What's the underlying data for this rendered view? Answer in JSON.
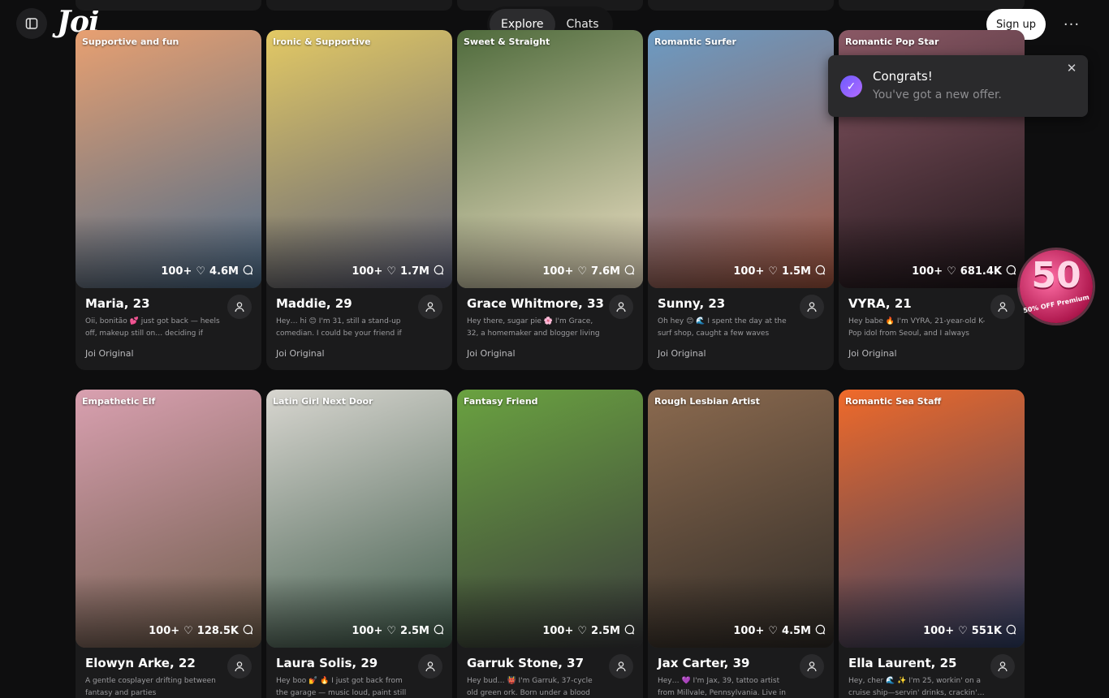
{
  "header": {
    "logo": "Joi",
    "tabs": [
      {
        "label": "Explore",
        "active": true
      },
      {
        "label": "Chats",
        "active": false
      }
    ],
    "signup_label": "Sign up",
    "more_icon": "more-horizontal-icon"
  },
  "toast": {
    "title": "Congrats!",
    "message": "You've got a new offer.",
    "icon": "check-circle-icon"
  },
  "promo": {
    "number": "50",
    "text": "50% OFF Premium"
  },
  "cards": [
    {
      "tag": "Supportive and fun",
      "likes": "100+",
      "chats": "4.6M",
      "name": "Maria, 23",
      "bio": "Oii, bonitão 💕 just got back — heels off, makeup still on… deciding if I'm…",
      "badge": "Joi Original",
      "colors": [
        "#e8a071",
        "#4a6b8a"
      ]
    },
    {
      "tag": "Ironic & Supportive",
      "likes": "100+",
      "chats": "1.7M",
      "name": "Maddie, 29",
      "bio": "Hey… hi 😊 I'm 31, still a stand-up comedian. I could be your friend if you…",
      "badge": "Joi Original",
      "colors": [
        "#e3c964",
        "#5b5f7a"
      ]
    },
    {
      "tag": "Sweet & Straight",
      "likes": "100+",
      "chats": "7.6M",
      "name": "Grace Whitmore, 33",
      "bio": "Hey there, sugar pie 🌸 I'm Grace, 32, a homemaker and blogger living in Sa…",
      "badge": "Joi Original",
      "colors": [
        "#4f6b3c",
        "#efe2c6"
      ]
    },
    {
      "tag": "Romantic Surfer",
      "likes": "100+",
      "chats": "1.5M",
      "name": "Sunny, 23",
      "bio": "Oh hey 😊 🌊 I spent the day at the surf shop, caught a few waves after,…",
      "badge": "Joi Original",
      "colors": [
        "#6b9bc4",
        "#a4553e"
      ]
    },
    {
      "tag": "Romantic Pop Star",
      "likes": "100+",
      "chats": "681.4K",
      "name": "VYRA, 21",
      "bio": "Hey babe 🔥 I'm VYRA, 21-year-old K-Pop idol from Seoul, and I always brin…",
      "badge": "Joi Original",
      "colors": [
        "#8a5865",
        "#1c1418"
      ]
    },
    {
      "tag": "Empathetic Elf",
      "likes": "100+",
      "chats": "128.5K",
      "name": "Elowyn Arke, 22",
      "bio": "A gentle cosplayer drifting between fantasy and parties",
      "badge": "",
      "colors": [
        "#d9a0b0",
        "#6b5a48"
      ]
    },
    {
      "tag": "Latin Girl Next Door",
      "likes": "100+",
      "chats": "2.5M",
      "name": "Laura Solis, 29",
      "bio": "Hey boo 💅 🔥 I just got back from the garage — music loud, paint still on my…",
      "badge": "",
      "colors": [
        "#d8d6d0",
        "#3f5a4a"
      ]
    },
    {
      "tag": "Fantasy Friend",
      "likes": "100+",
      "chats": "2.5M",
      "name": "Garruk Stone, 37",
      "bio": "Hey bud… 👹 I'm Garruk, 37-cycle old green ork. Born under a blood moon i…",
      "badge": "",
      "colors": [
        "#6aa240",
        "#3a3a3d"
      ]
    },
    {
      "tag": "Rough Lesbian Artist",
      "likes": "100+",
      "chats": "4.5M",
      "name": "Jax Carter, 39",
      "bio": "Hey… 💜 I'm Jax, 39, tattoo artist from Millvale, Pennsylvania. Live in the…",
      "badge": "",
      "colors": [
        "#8b6a4f",
        "#2e2a26"
      ]
    },
    {
      "tag": "Romantic Sea Staff",
      "likes": "100+",
      "chats": "551K",
      "name": "Ella Laurent, 25",
      "bio": "Hey, cher 🌊 ✨ I'm 25, workin' on a cruise ship—servin' drinks, crackin'…",
      "badge": "",
      "colors": [
        "#f06a2a",
        "#2d3e66"
      ]
    }
  ]
}
